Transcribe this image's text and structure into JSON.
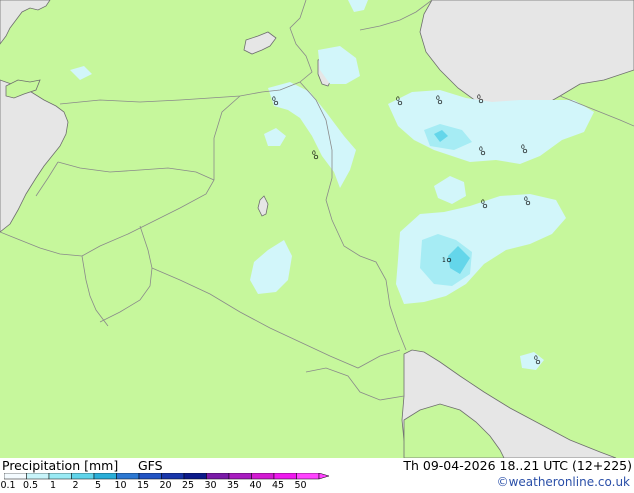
{
  "footer": {
    "title": "Precipitation [mm]",
    "model": "GFS",
    "valid": "Th 09-04-2026 18..21 UTC (12+225)",
    "credit": "©weatheronline.co.uk"
  },
  "legend": {
    "labels": [
      "0.1",
      "0.5",
      "1",
      "2",
      "5",
      "10",
      "15",
      "20",
      "25",
      "30",
      "35",
      "40",
      "45",
      "50"
    ],
    "colors": [
      "#f4fbff",
      "#c8f4fa",
      "#9aeaf4",
      "#60d4ea",
      "#2aaed8",
      "#2c78d2",
      "#2254c4",
      "#1836aa",
      "#0c1a8a",
      "#7a1aa8",
      "#a81cc0",
      "#d21ad2",
      "#ee1aee",
      "#ff44ff"
    ]
  },
  "map": {
    "colors": {
      "land": "#c6f79c",
      "sea": "#e6e6e6",
      "border": "#8a8a8a",
      "coast": "#6e6e6e",
      "rain_light": "#d2f6fa",
      "rain_mid": "#a6ecf4",
      "rain_heavy": "#64d6ea"
    },
    "point_values": [
      "0",
      "0",
      "0",
      "0",
      "0",
      "0",
      "0",
      "0",
      "0",
      "1",
      "0"
    ]
  }
}
